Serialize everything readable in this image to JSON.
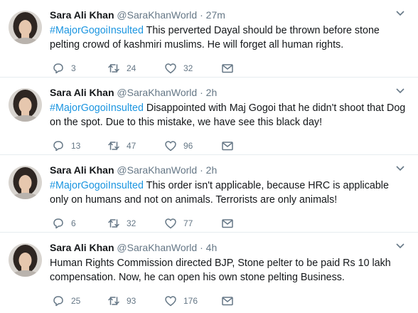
{
  "tweets": [
    {
      "name": "Sara Ali Khan",
      "handle": "@SaraKhanWorld",
      "dot": "·",
      "time": "27m",
      "hashtag": "#MajorGogoiInsulted",
      "text": " This perverted Dayal should be thrown before stone pelting crowd of kashmiri muslims. He will forget all human rights.",
      "replies": "3",
      "retweets": "24",
      "likes": "32"
    },
    {
      "name": "Sara Ali Khan",
      "handle": "@SaraKhanWorld",
      "dot": "·",
      "time": "2h",
      "hashtag": "#MajorGogoiInsulted",
      "text": " Disappointed with Maj Gogoi that he didn't shoot that Dog on the spot. Due to this mistake, we have see this black day!",
      "replies": "13",
      "retweets": "47",
      "likes": "96"
    },
    {
      "name": "Sara Ali Khan",
      "handle": "@SaraKhanWorld",
      "dot": "·",
      "time": "2h",
      "hashtag": "#MajorGogoiInsulted",
      "text": " This order isn't applicable, because HRC is applicable only on humans and not on animals. Terrorists are only animals!",
      "replies": "6",
      "retweets": "32",
      "likes": "77"
    },
    {
      "name": "Sara Ali Khan",
      "handle": "@SaraKhanWorld",
      "dot": "·",
      "time": "4h",
      "hashtag": "",
      "text": "Human Rights Commission directed BJP, Stone pelter to be paid Rs 10 lakh compensation. Now, he can open his own stone pelting Business.",
      "replies": "25",
      "retweets": "93",
      "likes": "176"
    }
  ],
  "icons": {
    "reply": "reply-icon",
    "retweet": "retweet-icon",
    "like": "heart-icon",
    "dm": "envelope-icon",
    "caret": "chevron-down-icon"
  },
  "colors": {
    "hashtag": "#1b95e0",
    "meta": "#657786",
    "text": "#14171a",
    "divider": "#e6ecf0"
  }
}
